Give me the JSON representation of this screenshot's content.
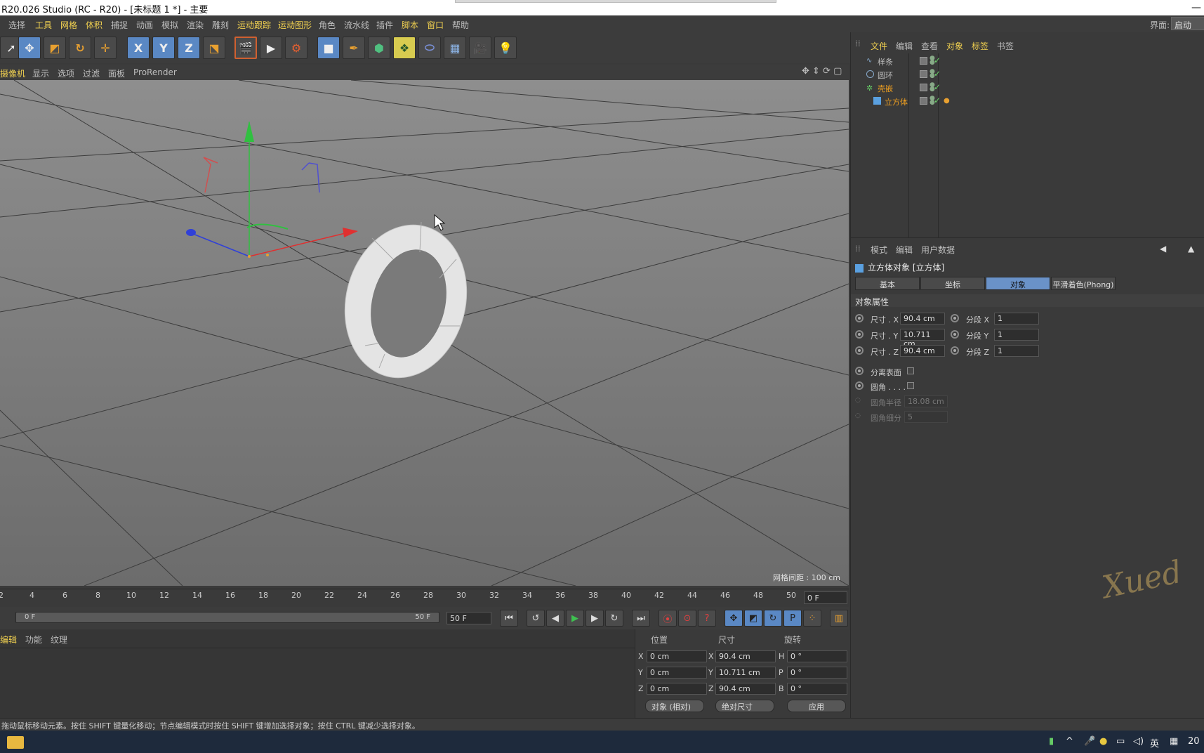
{
  "window": {
    "title": "R20.026 Studio (RC - R20) - [未标题 1 *] - 主要"
  },
  "menu": {
    "items": [
      "选择",
      "工具",
      "网格",
      "体积",
      "捕捉",
      "动画",
      "模拟",
      "渲染",
      "雕刻",
      "运动跟踪",
      "运动图形",
      "角色",
      "流水线",
      "插件",
      "脚本",
      "窗口",
      "帮助"
    ],
    "layout_label": "界面:",
    "layout_value": "启动"
  },
  "toolbar": {
    "icons": [
      "select-arrow-icon",
      "move-icon",
      "scale-icon",
      "rotate-icon",
      "move-tool-icon",
      "x-axis-icon",
      "y-axis-icon",
      "z-axis-icon",
      "world-coord-icon",
      "render-region-icon",
      "render-view-icon",
      "render-settings-icon",
      "cube-icon",
      "pen-icon",
      "subdivision-icon",
      "array-icon",
      "deformer-icon",
      "floor-icon",
      "camera-icon",
      "light-icon"
    ],
    "axis_labels": [
      "X",
      "Y",
      "Z"
    ]
  },
  "viewport": {
    "menu": [
      "摄像机",
      "显示",
      "选项",
      "过滤",
      "面板",
      "ProRender"
    ],
    "grid_spacing": "网格间距 : 100 cm"
  },
  "timeline": {
    "ticks": [
      "2",
      "4",
      "6",
      "8",
      "10",
      "12",
      "14",
      "16",
      "18",
      "20",
      "22",
      "24",
      "26",
      "28",
      "30",
      "32",
      "34",
      "36",
      "38",
      "40",
      "42",
      "44",
      "46",
      "48",
      "50"
    ],
    "current_frame": "0 F",
    "range_start": "0 F",
    "range_end": "50 F",
    "end_frame": "50 F"
  },
  "bottom_panel": {
    "tabs": [
      "编辑",
      "功能",
      "纹理"
    ]
  },
  "coords": {
    "headers": [
      "位置",
      "尺寸",
      "旋转"
    ],
    "axes": [
      "X",
      "Y",
      "Z"
    ],
    "rot_axes": [
      "H",
      "P",
      "B"
    ],
    "position": [
      "0 cm",
      "0 cm",
      "0 cm"
    ],
    "size": [
      "90.4 cm",
      "10.711 cm",
      "90.4 cm"
    ],
    "rotation": [
      "0 °",
      "0 °",
      "0 °"
    ],
    "mode_dropdown": "对象 (相对)",
    "size_dropdown": "绝对尺寸",
    "apply": "应用"
  },
  "status": {
    "text": "拖动鼠标移动元素。按住 SHIFT 键量化移动；节点编辑模式时按住 SHIFT 键增加选择对象；按住 CTRL 键减少选择对象。"
  },
  "object_manager": {
    "menu": [
      "文件",
      "编辑",
      "查看",
      "对象",
      "标签",
      "书签"
    ],
    "objects": [
      {
        "name": "样条"
      },
      {
        "name": "圆环"
      },
      {
        "name": "壳嵌"
      },
      {
        "name": "立方体"
      }
    ]
  },
  "attributes": {
    "menu": [
      "模式",
      "编辑",
      "用户数据"
    ],
    "header": "立方体对象 [立方体]",
    "tabs": [
      "基本",
      "坐标",
      "对象",
      "平滑着色(Phong)"
    ],
    "section": "对象属性",
    "size_x_label": "尺寸 . X",
    "size_x": "90.4 cm",
    "size_y_label": "尺寸 . Y",
    "size_y": "10.711 cm",
    "size_z_label": "尺寸 . Z",
    "size_z": "90.4 cm",
    "seg_x_label": "分段 X",
    "seg_x": "1",
    "seg_y_label": "分段 Y",
    "seg_y": "1",
    "seg_z_label": "分段 Z",
    "seg_z": "1",
    "separate_label": "分离表面",
    "fillet_label": "圆角 . . . .",
    "fillet_radius_label": "圆角半径",
    "fillet_radius": "18.08 cm",
    "fillet_sub_label": "圆角细分",
    "fillet_sub": "5"
  },
  "taskbar": {
    "lang": "英",
    "clock": "20"
  },
  "colors": {
    "accent": "#f0d050",
    "selected_tab": "#6a92c8",
    "selected_object": "#f0a020"
  }
}
